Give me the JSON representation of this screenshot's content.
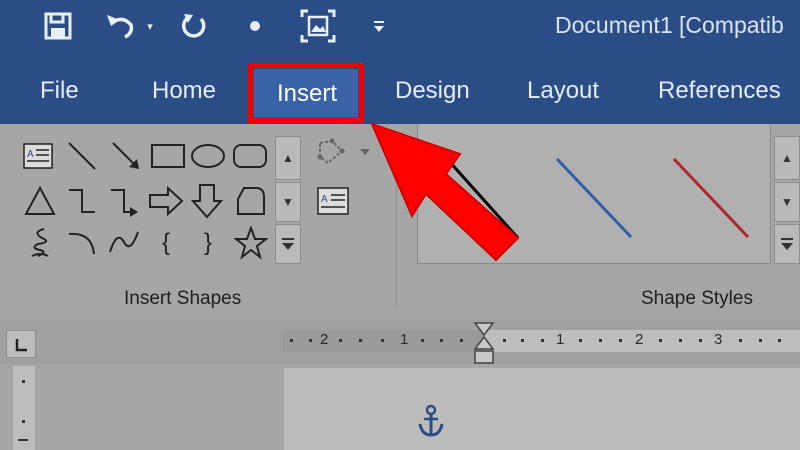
{
  "window": {
    "title": "Document1 [Compatib"
  },
  "quick_access": {
    "icons": [
      "save-icon",
      "undo-icon",
      "redo-icon",
      "bullet-icon",
      "screenshot-icon",
      "customize-icon"
    ]
  },
  "tabs": [
    {
      "id": "file",
      "label": "File"
    },
    {
      "id": "home",
      "label": "Home"
    },
    {
      "id": "insert",
      "label": "Insert",
      "selected": true
    },
    {
      "id": "design",
      "label": "Design"
    },
    {
      "id": "layout",
      "label": "Layout"
    },
    {
      "id": "references",
      "label": "References"
    }
  ],
  "ribbon": {
    "insert_shapes_label": "Insert Shapes",
    "shape_styles_label": "Shape Styles",
    "shapes": [
      "text-box-icon",
      "line-icon",
      "arrow-line-icon",
      "rectangle-icon",
      "oval-icon",
      "rounded-rectangle-icon",
      "triangle-icon",
      "elbow-connector-icon",
      "elbow-arrow-connector-icon",
      "right-arrow-icon",
      "down-arrow-icon",
      "flowchart-icon",
      "scribble-icon",
      "arc-icon",
      "wave-icon",
      "left-brace-icon",
      "right-brace-icon",
      "star-icon"
    ],
    "style_swatches": [
      "#000000",
      "#2e5ea8",
      "#b0262a"
    ]
  },
  "ruler": {
    "labels": [
      "2",
      "1",
      "1",
      "2",
      "3"
    ]
  },
  "colors": {
    "title_bar": "#2b4d86",
    "highlight": "#f00000"
  }
}
